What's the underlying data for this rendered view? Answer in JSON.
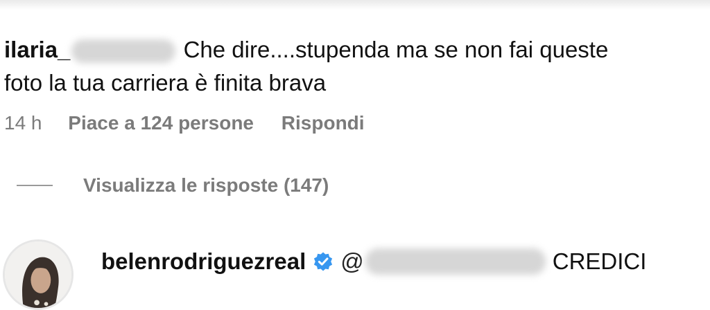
{
  "comment": {
    "username": "ilaria_",
    "text_line1": "Che dire....stupenda ma se non fai queste",
    "text_line2": "foto la tua carriera è finita brava",
    "time": "14 h",
    "likes_label": "Piace a 124 persone",
    "reply_label": "Rispondi"
  },
  "replies_toggle": {
    "label": "Visualizza le risposte (147)"
  },
  "reply": {
    "username": "belenrodriguezreal",
    "mention_prefix": "@",
    "text": "CREDICI",
    "avatar_icon": "profile-photo",
    "verified_icon": "verified-badge-icon",
    "verified_color": "#3797f0"
  }
}
